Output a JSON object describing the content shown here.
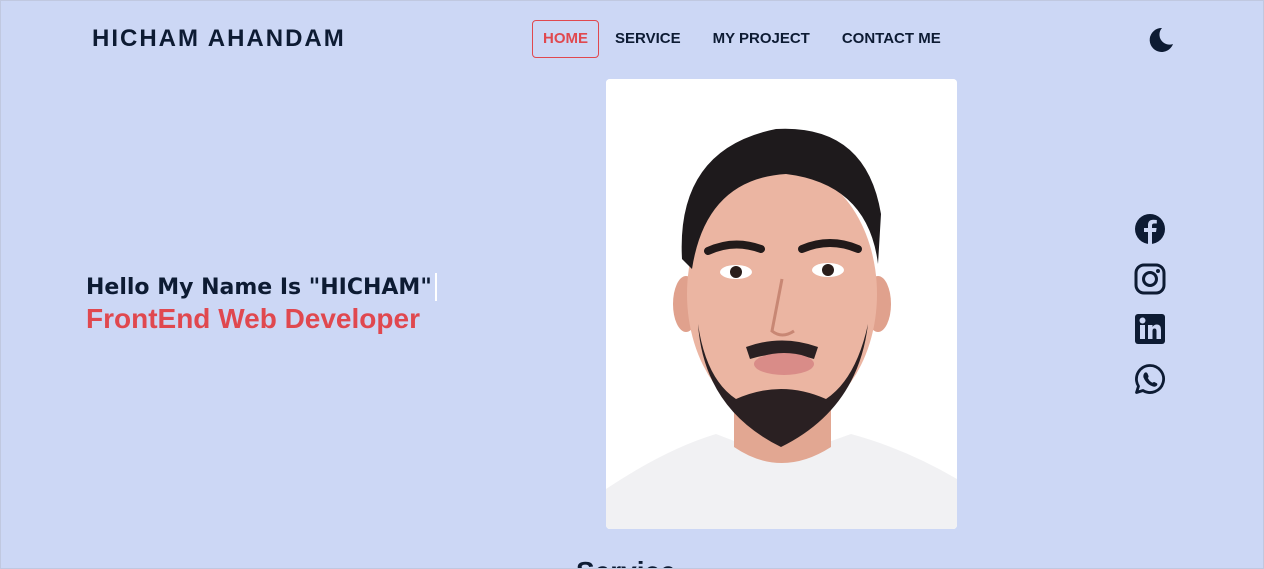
{
  "header": {
    "logo": "HICHAM AHANDAM",
    "nav": [
      {
        "label": "HOME",
        "active": true
      },
      {
        "label": "SERVICE",
        "active": false
      },
      {
        "label": "MY PROJECT",
        "active": false
      },
      {
        "label": "CONTACT ME",
        "active": false
      }
    ],
    "theme_icon": "moon-icon"
  },
  "hero": {
    "greeting": "Hello My Name Is \"HICHAM\"",
    "role": "FrontEnd Web Developer",
    "photo_alt": "profile-photo"
  },
  "social": [
    {
      "icon": "facebook-icon"
    },
    {
      "icon": "instagram-icon"
    },
    {
      "icon": "linkedin-icon"
    },
    {
      "icon": "whatsapp-icon"
    }
  ],
  "next_section": {
    "heading": "Service"
  },
  "colors": {
    "background": "#ccd7f5",
    "text": "#0d1b33",
    "accent": "#e0484f"
  }
}
